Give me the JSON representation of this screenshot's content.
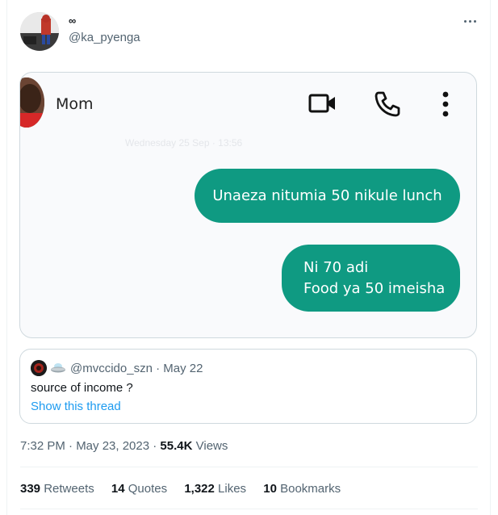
{
  "author": {
    "display_name": "∞",
    "handle": "@ka_pyenga"
  },
  "menu": {
    "icon": "more-horizontal-icon"
  },
  "chat": {
    "contact_name": "Mom",
    "icons": [
      "video-call-icon",
      "phone-icon",
      "more-vertical-icon"
    ],
    "date_stamp": "Wednesday 25 Sep · 13:56",
    "messages": [
      {
        "lines": [
          "Unaeza nitumia 50 nikule lunch"
        ]
      },
      {
        "lines": [
          "Ni 70 adi",
          "Food ya 50 imeisha"
        ]
      }
    ],
    "bubble_color": "#0f9a82"
  },
  "quote": {
    "handle": "@mvccido_szn",
    "separator": "·",
    "date": "May 22",
    "text": "source of income ?",
    "link": "Show this thread"
  },
  "meta": {
    "time": "7:32 PM · May 23, 2023 ·",
    "views_count": "55.4K",
    "views_label": "Views"
  },
  "stats": [
    {
      "count": "339",
      "label": "Retweets"
    },
    {
      "count": "14",
      "label": "Quotes"
    },
    {
      "count": "1,322",
      "label": "Likes"
    },
    {
      "count": "10",
      "label": "Bookmarks"
    }
  ],
  "colors": {
    "link": "#1d9bf0",
    "muted": "#536471",
    "border": "#cfd9de"
  }
}
